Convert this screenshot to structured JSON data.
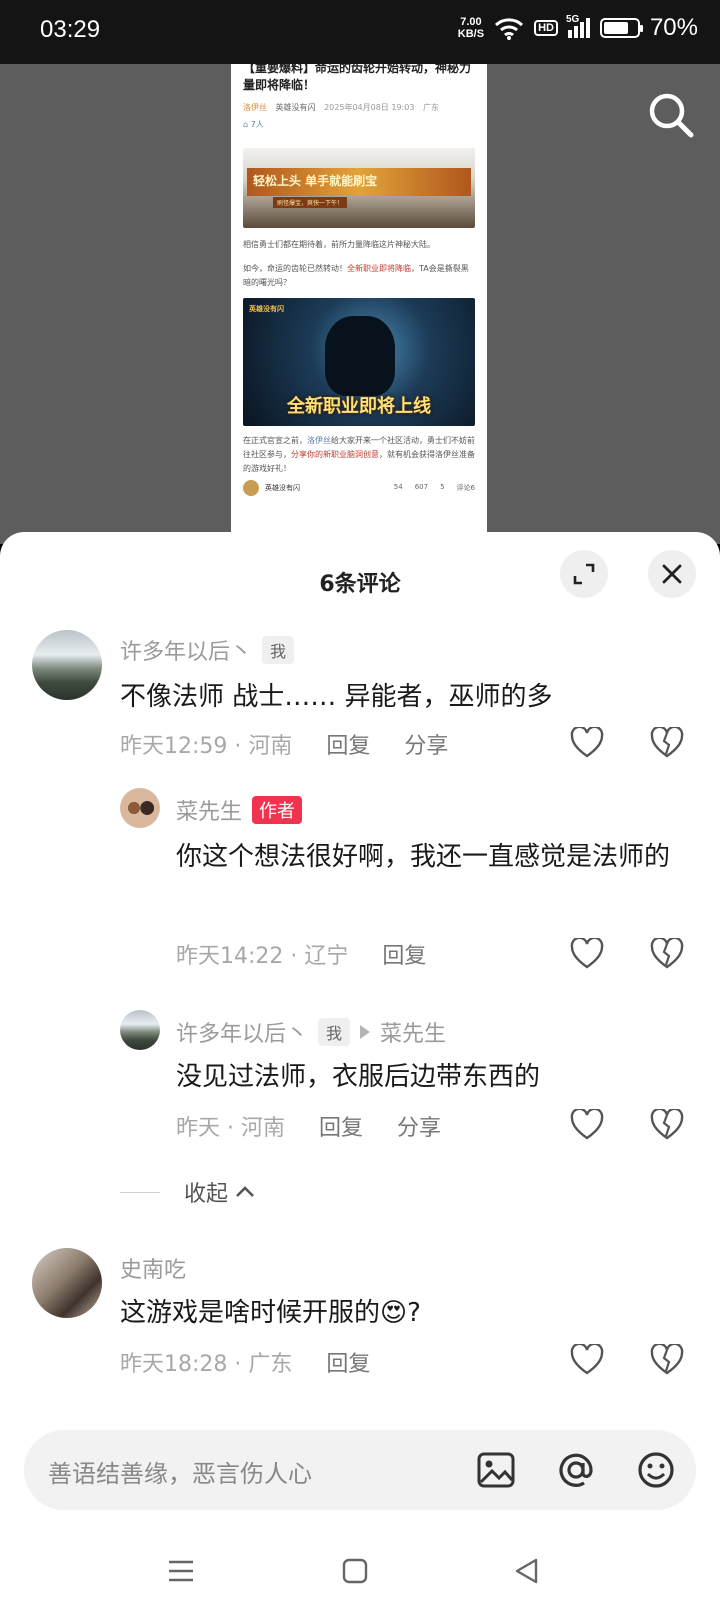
{
  "status_bar": {
    "time": "03:29",
    "speed_value": "7.00",
    "speed_unit": "KB/S",
    "hd": "HD",
    "net": "5G",
    "battery": "70%",
    "battery_level": 0.7
  },
  "article": {
    "title": "【重要爆料】命运的齿轮开始转动，神秘力量即将降临！",
    "author": "洛伊丝",
    "channel": "英雄没有闪",
    "date": "2025年04月08日 19:03",
    "location": "广东",
    "views": "7人",
    "banner1_text": "轻松上头 单手就能刷宝",
    "banner1_sub": "刷怪爆宝，爽快一下午！",
    "para1": "相信勇士们都在期待着，前所力量降临这片神秘大陆。",
    "para2_a": "如今，命运的齿轮已然转动！",
    "para2_red": "全新职业即将降临",
    "para2_b": "，TA会是撕裂黑暗的曙光吗？",
    "banner2_logo": "英雄没有闪",
    "banner2_caption": "全新职业即将上线",
    "para3_a": "在正式官宣之前，",
    "para3_name": "洛伊丝",
    "para3_b": "给大家开来一个社区活动，勇士们不妨前往社区参与，",
    "para3_red": "分享你的新职业脑洞创意",
    "para3_c": "，就有机会获得洛伊丝准备的游戏好礼！",
    "footer_name": "英雄没有闪",
    "stat_like": "54",
    "stat_share": "607",
    "stat_heart": "5",
    "stat_comment": "评论6"
  },
  "sheet": {
    "title": "6条评论"
  },
  "comments": [
    {
      "user": "许多年以后丶",
      "tag": "我",
      "text": "不像法师  战士……  异能者，巫师的多",
      "time_loc": "昨天12:59 · 河南",
      "reply": "回复",
      "share": "分享"
    },
    {
      "user": "菜先生",
      "tag": "作者",
      "text": "你这个想法很好啊，我还一直感觉是法师的",
      "time_loc": "昨天14:22 · 辽宁",
      "reply": "回复"
    },
    {
      "user": "许多年以后丶",
      "tag": "我",
      "reply_to": "菜先生",
      "text": "没见过法师，衣服后边带东西的",
      "time_loc": "昨天 · 河南",
      "reply": "回复",
      "share": "分享"
    },
    {
      "user": "史南吃",
      "text": "这游戏是啥时候开服的😍?",
      "time_loc": "昨天18:28 · 广东",
      "reply": "回复"
    }
  ],
  "collapse_label": "收起",
  "input": {
    "placeholder": "善语结善缘，恶言伤人心"
  },
  "icons": {
    "search": "search-icon",
    "expand": "expand-icon",
    "close": "close-icon",
    "like": "heart-icon",
    "dislike": "broken-heart-icon",
    "image": "image-icon",
    "mention": "at-icon",
    "emoji": "emoji-icon",
    "menu": "menu-icon",
    "home": "home-icon",
    "back": "back-icon"
  },
  "colors": {
    "author_tag": "#f0334f",
    "sheet_bg": "#ffffff",
    "viewer_bg": "#5d5d5d"
  }
}
